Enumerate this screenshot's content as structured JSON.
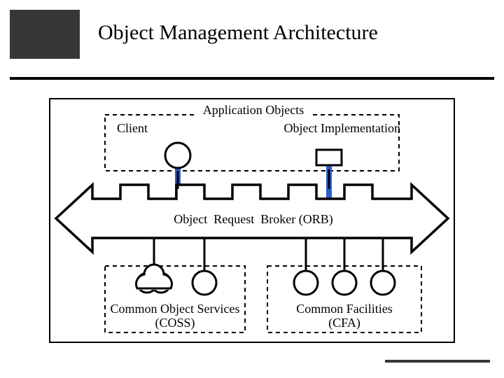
{
  "title": "Object Management Architecture",
  "labels": {
    "app_objects": "Application Objects",
    "client": "Client",
    "obj_impl": "Object Implementation",
    "orb": "Object  Request  Broker (ORB)",
    "coss": "Common Object Services\n(COSS)",
    "cfa": "Common Facilities\n(CFA)"
  }
}
